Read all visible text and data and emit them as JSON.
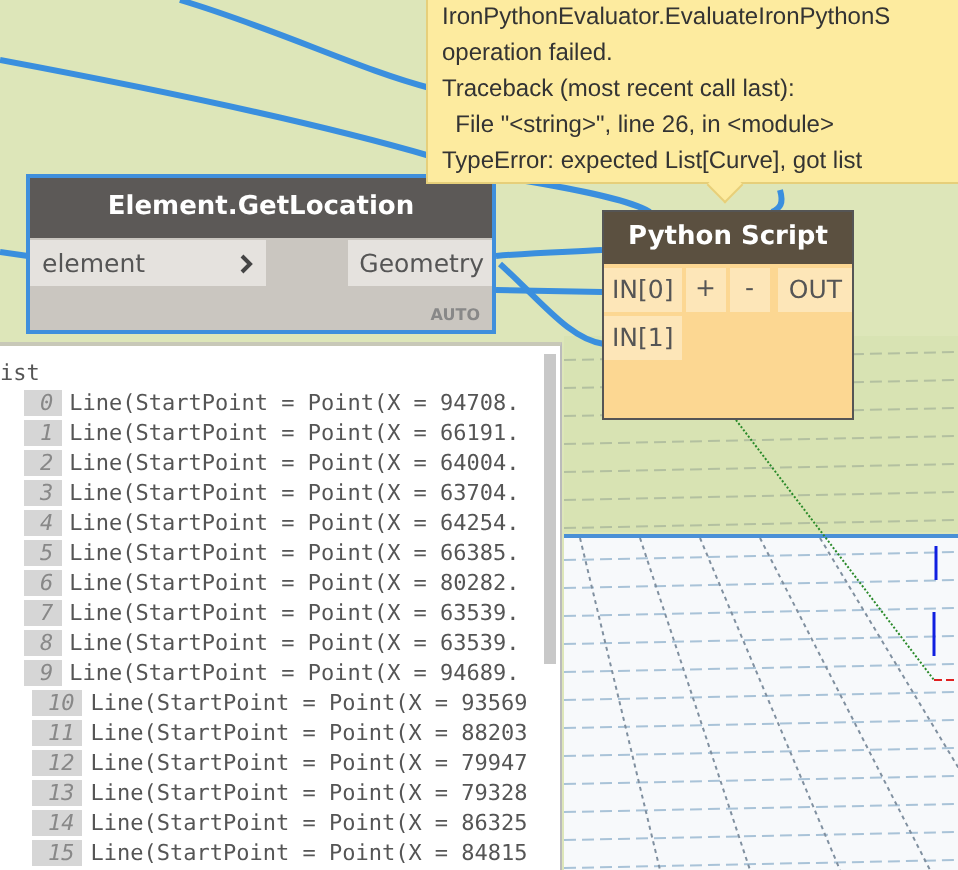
{
  "tooltip": {
    "lines": [
      "IronPythonEvaluator.EvaluateIronPythonS",
      "operation failed.",
      "Traceback (most recent call last):",
      "  File \"<string>\", line 26, in <module>",
      "TypeError: expected List[Curve], got list"
    ]
  },
  "nodes": [
    {
      "kind": "element",
      "title": "Element.GetLocation",
      "selected": true,
      "inputs": [
        "element"
      ],
      "outputs": [
        "Geometry"
      ],
      "lacing": "AUTO"
    },
    {
      "kind": "python",
      "title": "Python Script",
      "selected": false,
      "inputs": [
        "IN[0]",
        "IN[1]"
      ],
      "add": "+",
      "remove": "-",
      "outputs": [
        "OUT"
      ]
    }
  ],
  "watch": {
    "title": "ist",
    "items": [
      {
        "index": "0",
        "value": "Line(StartPoint = Point(X = 94708."
      },
      {
        "index": "1",
        "value": "Line(StartPoint = Point(X = 66191."
      },
      {
        "index": "2",
        "value": "Line(StartPoint = Point(X = 64004."
      },
      {
        "index": "3",
        "value": "Line(StartPoint = Point(X = 63704."
      },
      {
        "index": "4",
        "value": "Line(StartPoint = Point(X = 64254."
      },
      {
        "index": "5",
        "value": "Line(StartPoint = Point(X = 66385."
      },
      {
        "index": "6",
        "value": "Line(StartPoint = Point(X = 80282."
      },
      {
        "index": "7",
        "value": "Line(StartPoint = Point(X = 63539."
      },
      {
        "index": "8",
        "value": "Line(StartPoint = Point(X = 63539."
      },
      {
        "index": "9",
        "value": "Line(StartPoint = Point(X = 94689."
      },
      {
        "index": "10",
        "value": "Line(StartPoint = Point(X = 93569"
      },
      {
        "index": "11",
        "value": "Line(StartPoint = Point(X = 88203"
      },
      {
        "index": "12",
        "value": "Line(StartPoint = Point(X = 79947"
      },
      {
        "index": "13",
        "value": "Line(StartPoint = Point(X = 79328"
      },
      {
        "index": "14",
        "value": "Line(StartPoint = Point(X = 86325"
      },
      {
        "index": "15",
        "value": "Line(StartPoint = Point(X = 84815"
      }
    ]
  }
}
